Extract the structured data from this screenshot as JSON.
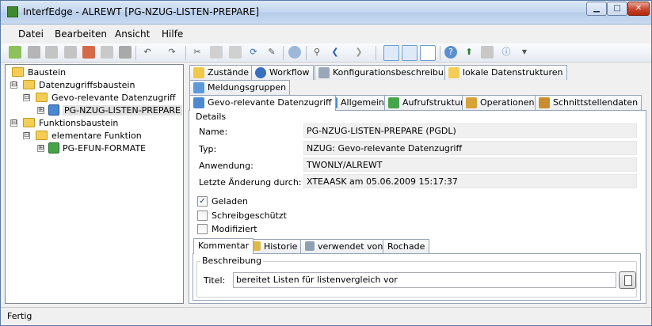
{
  "window": {
    "title": "InterfEdge - ALREWT [PG-NZUG-LISTEN-PREPARE]",
    "min": "▁",
    "max": "□",
    "close": "✕"
  },
  "menu": [
    "Datei",
    "Bearbeiten",
    "Ansicht",
    "Hilfe"
  ],
  "tree": {
    "items": [
      {
        "label": "Baustein",
        "expander": "⊟"
      },
      {
        "label": "Datenzugriffsbaustein",
        "expander": "⊟"
      },
      {
        "label": "Gevo-relevante Datenzugriff",
        "expander": "⊟"
      },
      {
        "label": "PG-NZUG-LISTEN-PREPARE",
        "expander": "⊞"
      },
      {
        "label": "Funktionsbaustein",
        "expander": "⊟"
      },
      {
        "label": "elementare Funktion",
        "expander": "⊟"
      },
      {
        "label": "PG-EFUN-FORMATE",
        "expander": "⊞"
      }
    ]
  },
  "tabs_row1": [
    "Zustände",
    "Workflow",
    "Konfigurationsbeschreibung",
    "lokale Datenstrukturen"
  ],
  "tabs_row2": [
    "Meldungsgruppen"
  ],
  "tabs_row3": [
    "Gevo-relevante Datenzugriff",
    "Allgemein",
    "Aufrufstruktur",
    "Operationen",
    "Schnittstellendaten"
  ],
  "details": {
    "group_label": "Details",
    "name_label": "Name:",
    "name_value": "PG-NZUG-LISTEN-PREPARE (PGDL)",
    "typ_label": "Typ:",
    "typ_value": "NZUG: Gevo-relevante Datenzugriff",
    "anwendung_label": "Anwendung:",
    "anwendung_value": "TWONLY/ALREWT",
    "aenderung_label": "Letzte Änderung durch:",
    "aenderung_value": "XTEAASK am 05.06.2009 15:17:37"
  },
  "checkboxes": [
    {
      "label": "Geladen",
      "checked": true,
      "mark": "✓"
    },
    {
      "label": "Schreibgeschützt",
      "checked": false,
      "mark": ""
    },
    {
      "label": "Modifiziert",
      "checked": false,
      "mark": ""
    }
  ],
  "subtabs": [
    "Kommentar",
    "Historie",
    "verwendet von",
    "Rochade"
  ],
  "beschreibung": {
    "group_label": "Beschreibung",
    "titel_label": "Titel:",
    "titel_value": "bereitet Listen für listenvergleich vor"
  },
  "status": "Fertig",
  "colors": {
    "accent": "#4c89d3",
    "folder": "#f3cd55",
    "close": "#c9442c"
  }
}
